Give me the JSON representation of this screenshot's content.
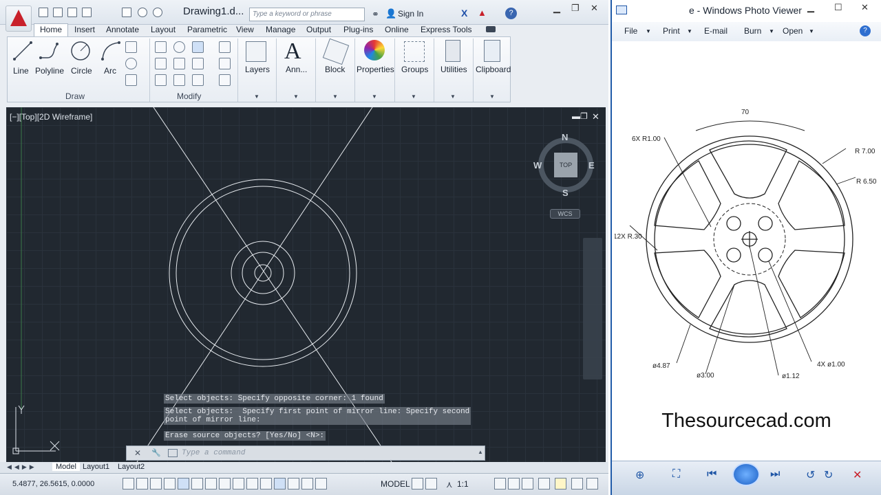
{
  "acad": {
    "doc_title": "Drawing1.d...",
    "search_placeholder": "Type a keyword or phrase",
    "sign_in": "Sign In",
    "help": "?",
    "tabs": [
      "Home",
      "Insert",
      "Annotate",
      "Layout",
      "Parametric",
      "View",
      "Manage",
      "Output",
      "Plug-ins",
      "Online",
      "Express Tools"
    ],
    "draw_tools": [
      "Line",
      "Polyline",
      "Circle",
      "Arc"
    ],
    "panel_draw": "Draw",
    "panel_modify": "Modify",
    "big_tools": [
      "Layers",
      "Ann...",
      "Block",
      "Properties",
      "Groups",
      "Utilities",
      "Clipboard"
    ],
    "viewport_label": "[−][Top][2D Wireframe]",
    "viewcube": {
      "n": "N",
      "s": "S",
      "e": "E",
      "w": "W",
      "top": "TOP",
      "wcs": "WCS"
    },
    "command_history": [
      "Select objects: Specify opposite corner: 1 found",
      "Select objects:  Specify first point of mirror line: Specify second\npoint of mirror line:",
      "Erase source objects? [Yes/No] <N>:"
    ],
    "command_placeholder": "Type a command",
    "layout_tabs": [
      "Model",
      "Layout1",
      "Layout2"
    ],
    "coords": "5.4877, 26.5615, 0.0000",
    "status_model": "MODEL",
    "status_scale": "1:1",
    "colors": {
      "canvas": "#212830",
      "accent": "#c8202a"
    }
  },
  "viewer": {
    "title": "e - Windows Photo Viewer",
    "menu": [
      "File",
      "Print",
      "E-mail",
      "Burn",
      "Open"
    ],
    "site": "Thesourcecad.com",
    "drawing_labels": {
      "dim_top": "70",
      "r_outer": "R 7.00",
      "r_inner": "R 6.50",
      "spokes": "6X  R1.00",
      "fillet": "12X R.30",
      "d487": "ø4.87",
      "d300": "ø3.00",
      "d112": "ø1.12",
      "holes": "4X  ø1.00"
    }
  }
}
